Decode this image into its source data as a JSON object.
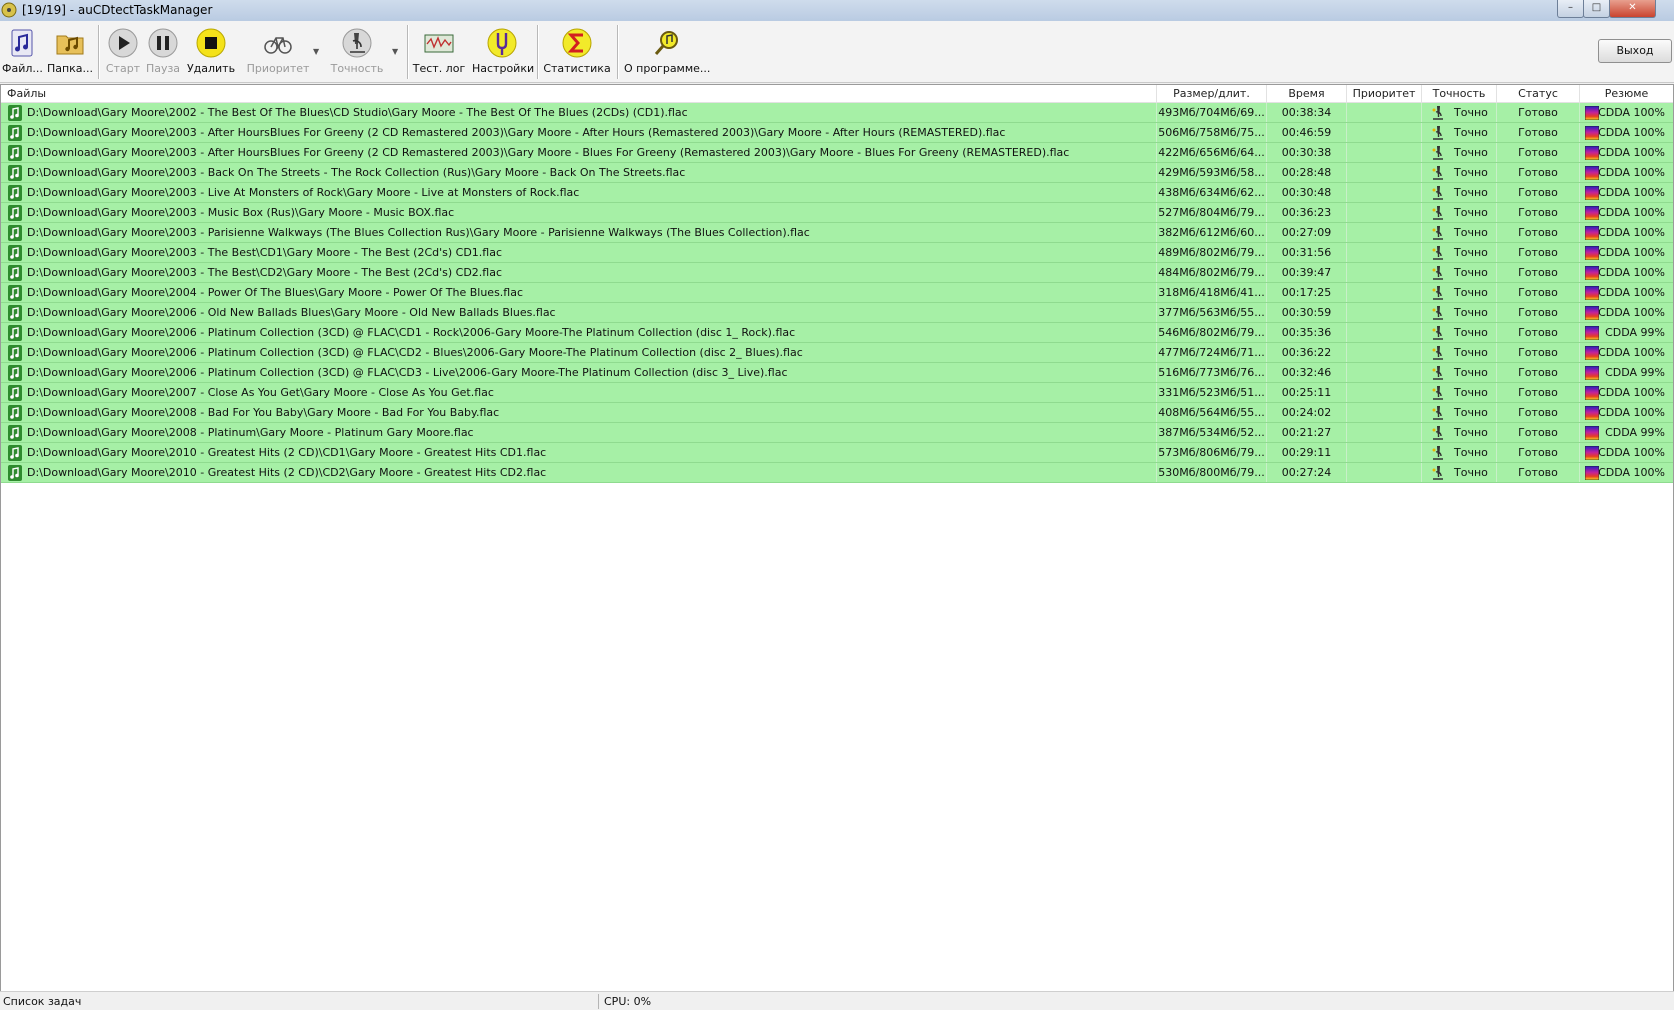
{
  "window": {
    "title": "[19/19] - auCDtectTaskManager",
    "controls": [
      "minimize",
      "maximize",
      "close"
    ]
  },
  "toolbar": {
    "buttons": [
      {
        "label": "Файл...",
        "icon": "music-file-icon",
        "enabled": true
      },
      {
        "label": "Папка...",
        "icon": "music-folder-icon",
        "enabled": true
      },
      {
        "label": "Старт",
        "icon": "play-icon",
        "enabled": false
      },
      {
        "label": "Пауза",
        "icon": "pause-icon",
        "enabled": false
      },
      {
        "label": "Удалить",
        "icon": "stop-icon",
        "enabled": true
      },
      {
        "label": "Приоритет",
        "icon": "bicycle-icon",
        "enabled": false
      },
      {
        "label": "Точность",
        "icon": "microscope-icon",
        "enabled": false
      },
      {
        "label": "Тест. лог",
        "icon": "test-log-icon",
        "enabled": true
      },
      {
        "label": "Настройки",
        "icon": "tuning-fork-icon",
        "enabled": true
      },
      {
        "label": "Статистика",
        "icon": "sigma-icon",
        "enabled": true
      },
      {
        "label": "О программе...",
        "icon": "about-magnifier-icon",
        "enabled": true
      }
    ],
    "exit_label": "Выход"
  },
  "table": {
    "headers": {
      "file": "Файлы",
      "size": "Размер/длит.",
      "time": "Время",
      "priority": "Приоритет",
      "accuracy": "Точность",
      "status": "Статус",
      "result": "Резюме"
    },
    "row_color": "#a6f0a6",
    "rows": [
      {
        "file": "D:\\Download\\Gary Moore\\2002 - The Best Of The Blues\\CD Studio\\Gary Moore - The Best Of The Blues (2CDs) (CD1).flac",
        "size": "493Мб/704Мб/69...",
        "time": "00:38:34",
        "priority": "",
        "accuracy": "Точно",
        "status": "Готово",
        "result": "CDDA 100%"
      },
      {
        "file": "D:\\Download\\Gary Moore\\2003 - After HoursBlues For Greeny (2 CD Remastered 2003)\\Gary Moore - After Hours (Remastered 2003)\\Gary Moore - After Hours (REMASTERED).flac",
        "size": "506Мб/758Мб/75...",
        "time": "00:46:59",
        "priority": "",
        "accuracy": "Точно",
        "status": "Готово",
        "result": "CDDA 100%"
      },
      {
        "file": "D:\\Download\\Gary Moore\\2003 - After HoursBlues For Greeny (2 CD Remastered 2003)\\Gary Moore - Blues For Greeny (Remastered 2003)\\Gary Moore - Blues For Greeny (REMASTERED).flac",
        "size": "422Мб/656Мб/64...",
        "time": "00:30:38",
        "priority": "",
        "accuracy": "Точно",
        "status": "Готово",
        "result": "CDDA 100%"
      },
      {
        "file": "D:\\Download\\Gary Moore\\2003 - Back On The Streets - The Rock Collection (Rus)\\Gary Moore - Back On The Streets.flac",
        "size": "429Мб/593Мб/58...",
        "time": "00:28:48",
        "priority": "",
        "accuracy": "Точно",
        "status": "Готово",
        "result": "CDDA 100%"
      },
      {
        "file": "D:\\Download\\Gary Moore\\2003 - Live At Monsters of Rock\\Gary Moore - Live at Monsters of Rock.flac",
        "size": "438Мб/634Мб/62...",
        "time": "00:30:48",
        "priority": "",
        "accuracy": "Точно",
        "status": "Готово",
        "result": "CDDA 100%"
      },
      {
        "file": "D:\\Download\\Gary Moore\\2003 - Music Box (Rus)\\Gary Moore - Music BOX.flac",
        "size": "527Мб/804Мб/79...",
        "time": "00:36:23",
        "priority": "",
        "accuracy": "Точно",
        "status": "Готово",
        "result": "CDDA 100%"
      },
      {
        "file": "D:\\Download\\Gary Moore\\2003 - Parisienne Walkways (The Blues Collection Rus)\\Gary Moore - Parisienne Walkways (The Blues Collection).flac",
        "size": "382Мб/612Мб/60...",
        "time": "00:27:09",
        "priority": "",
        "accuracy": "Точно",
        "status": "Готово",
        "result": "CDDA 100%"
      },
      {
        "file": "D:\\Download\\Gary Moore\\2003 - The Best\\CD1\\Gary Moore - The Best (2Cd's) CD1.flac",
        "size": "489Мб/802Мб/79...",
        "time": "00:31:56",
        "priority": "",
        "accuracy": "Точно",
        "status": "Готово",
        "result": "CDDA 100%"
      },
      {
        "file": "D:\\Download\\Gary Moore\\2003 - The Best\\CD2\\Gary Moore - The Best (2Cd's) CD2.flac",
        "size": "484Мб/802Мб/79...",
        "time": "00:39:47",
        "priority": "",
        "accuracy": "Точно",
        "status": "Готово",
        "result": "CDDA 100%"
      },
      {
        "file": "D:\\Download\\Gary Moore\\2004 - Power Of The Blues\\Gary Moore - Power Of The Blues.flac",
        "size": "318Мб/418Мб/41...",
        "time": "00:17:25",
        "priority": "",
        "accuracy": "Точно",
        "status": "Готово",
        "result": "CDDA 100%"
      },
      {
        "file": "D:\\Download\\Gary Moore\\2006 - Old New Ballads Blues\\Gary Moore - Old New Ballads Blues.flac",
        "size": "377Мб/563Мб/55...",
        "time": "00:30:59",
        "priority": "",
        "accuracy": "Точно",
        "status": "Готово",
        "result": "CDDA 100%"
      },
      {
        "file": "D:\\Download\\Gary Moore\\2006 - Platinum Collection (3CD) @ FLAC\\CD1 - Rock\\2006-Gary Moore-The Platinum Collection (disc 1_ Rock).flac",
        "size": "546Мб/802Мб/79...",
        "time": "00:35:36",
        "priority": "",
        "accuracy": "Точно",
        "status": "Готово",
        "result": "CDDA 99%"
      },
      {
        "file": "D:\\Download\\Gary Moore\\2006 - Platinum Collection (3CD) @ FLAC\\CD2 - Blues\\2006-Gary Moore-The Platinum Collection (disc 2_ Blues).flac",
        "size": "477Мб/724Мб/71...",
        "time": "00:36:22",
        "priority": "",
        "accuracy": "Точно",
        "status": "Готово",
        "result": "CDDA 100%"
      },
      {
        "file": "D:\\Download\\Gary Moore\\2006 - Platinum Collection (3CD) @ FLAC\\CD3 - Live\\2006-Gary Moore-The Platinum Collection (disc 3_ Live).flac",
        "size": "516Мб/773Мб/76...",
        "time": "00:32:46",
        "priority": "",
        "accuracy": "Точно",
        "status": "Готово",
        "result": "CDDA 99%"
      },
      {
        "file": "D:\\Download\\Gary Moore\\2007 - Close As You Get\\Gary Moore - Close As You Get.flac",
        "size": "331Мб/523Мб/51...",
        "time": "00:25:11",
        "priority": "",
        "accuracy": "Точно",
        "status": "Готово",
        "result": "CDDA 100%"
      },
      {
        "file": "D:\\Download\\Gary Moore\\2008 - Bad For You Baby\\Gary Moore - Bad For You Baby.flac",
        "size": "408Мб/564Мб/55...",
        "time": "00:24:02",
        "priority": "",
        "accuracy": "Точно",
        "status": "Готово",
        "result": "CDDA 100%"
      },
      {
        "file": "D:\\Download\\Gary Moore\\2008 - Platinum\\Gary Moore - Platinum  Gary Moore.flac",
        "size": "387Мб/534Мб/52...",
        "time": "00:21:27",
        "priority": "",
        "accuracy": "Точно",
        "status": "Готово",
        "result": "CDDA 99%"
      },
      {
        "file": "D:\\Download\\Gary Moore\\2010 - Greatest Hits (2 CD)\\CD1\\Gary Moore - Greatest Hits CD1.flac",
        "size": "573Мб/806Мб/79...",
        "time": "00:29:11",
        "priority": "",
        "accuracy": "Точно",
        "status": "Готово",
        "result": "CDDA 100%"
      },
      {
        "file": "D:\\Download\\Gary Moore\\2010 - Greatest Hits (2 CD)\\CD2\\Gary Moore - Greatest Hits CD2.flac",
        "size": "530Мб/800Мб/79...",
        "time": "00:27:24",
        "priority": "",
        "accuracy": "Точно",
        "status": "Готово",
        "result": "CDDA 100%"
      }
    ]
  },
  "statusbar": {
    "left": "Список задач",
    "cpu": "CPU: 0%"
  }
}
